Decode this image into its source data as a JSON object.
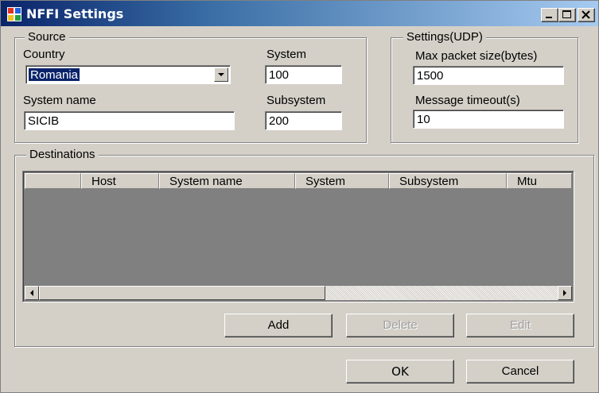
{
  "window": {
    "title": "NFFI Settings",
    "minimize_icon": "minimize-icon",
    "maximize_icon": "maximize-icon",
    "close_icon": "close-icon"
  },
  "source": {
    "legend": "Source",
    "country_label": "Country",
    "country_value": "Romania",
    "system_label": "System",
    "system_value": "100",
    "system_name_label": "System name",
    "system_name_value": "SICIB",
    "subsystem_label": "Subsystem",
    "subsystem_value": "200"
  },
  "settings": {
    "legend": "Settings(UDP)",
    "max_packet_label": "Max packet size(bytes)",
    "max_packet_value": "1500",
    "timeout_label": "Message timeout(s)",
    "timeout_value": "10"
  },
  "destinations": {
    "legend": "Destinations",
    "columns": [
      "",
      "Host",
      "System name",
      "System",
      "Subsystem",
      "Mtu"
    ],
    "rows": [],
    "add_label": "Add",
    "delete_label": "Delete",
    "edit_label": "Edit"
  },
  "footer": {
    "ok_label": "OK",
    "cancel_label": "Cancel"
  },
  "colors": {
    "title_gradient_start": "#0a246a",
    "face": "#d4d0c8",
    "list_background": "#808080",
    "selection": "#0a246a"
  }
}
